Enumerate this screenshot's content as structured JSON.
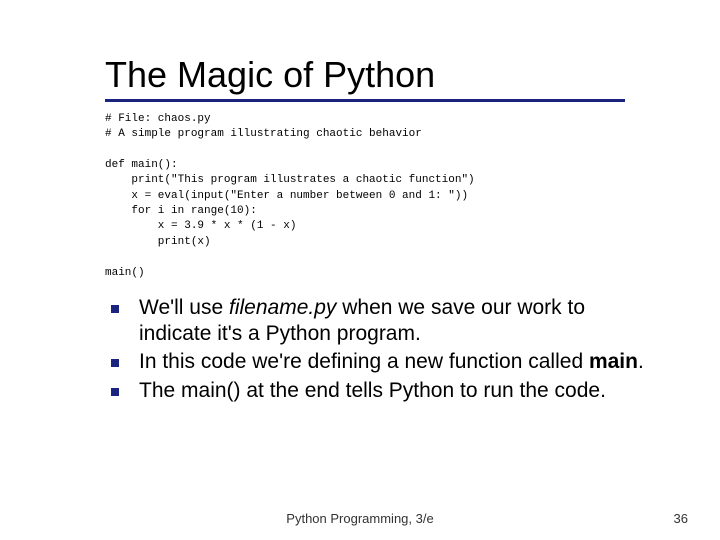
{
  "title": "The Magic of Python",
  "code": "# File: chaos.py\n# A simple program illustrating chaotic behavior\n\ndef main():\n    print(\"This program illustrates a chaotic function\")\n    x = eval(input(\"Enter a number between 0 and 1: \"))\n    for i in range(10):\n        x = 3.9 * x * (1 - x)\n        print(x)\n\nmain()",
  "bullets": [
    {
      "pre": "We'll use ",
      "em": "filename.py",
      "post": " when we save our work to indicate it's a Python program."
    },
    {
      "pre": "In this code we're defining a new function called ",
      "strong": "main",
      "post": "."
    },
    {
      "pre": "The main() at the end tells Python to run the code.",
      "post": ""
    }
  ],
  "footer": {
    "center": "Python Programming, 3/e",
    "page": "36"
  }
}
